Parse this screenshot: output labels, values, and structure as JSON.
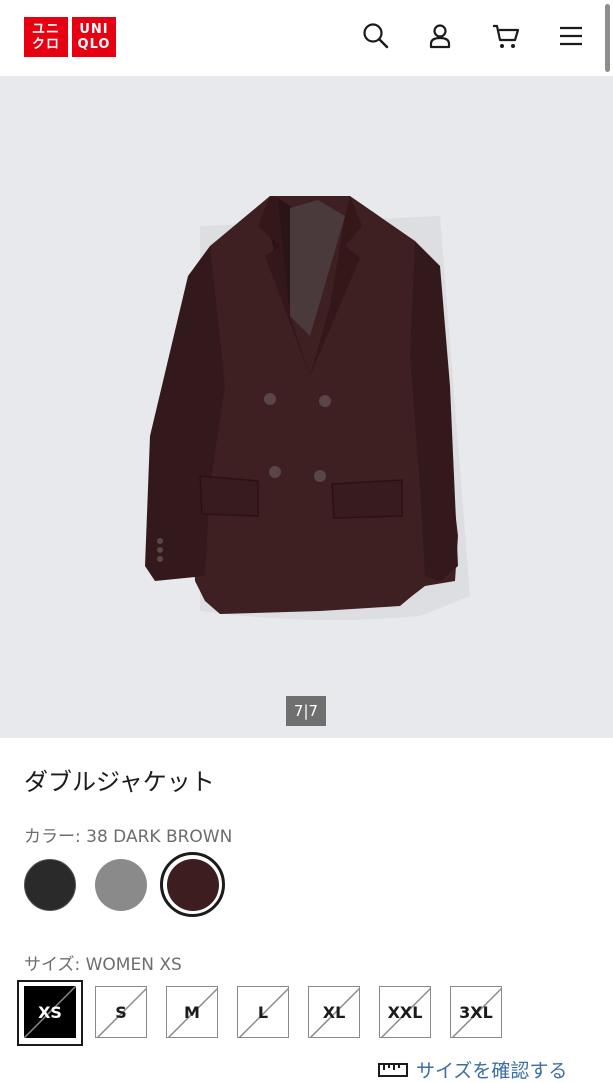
{
  "header": {
    "logo_top": "ユニ",
    "logo_bottom": "クロ",
    "logo_top_latin": "UNI",
    "logo_bottom_latin": "QLO",
    "icons": [
      "search-icon",
      "account-icon",
      "cart-icon",
      "menu-icon"
    ]
  },
  "gallery": {
    "counter": "7|7",
    "background": "#e8e9ec"
  },
  "product": {
    "title": "ダブルジャケット",
    "color_label": "カラー: 38 DARK BROWN",
    "colors": [
      {
        "name": "black",
        "hex": "#2a2a2a"
      },
      {
        "name": "gray",
        "hex": "#8a8a8a"
      },
      {
        "name": "dark-brown",
        "hex": "#3d1d1f",
        "selected": true
      }
    ],
    "size_label": "サイズ: WOMEN XS",
    "sizes": [
      "XS",
      "S",
      "M",
      "L",
      "XL",
      "XXL",
      "3XL"
    ],
    "selected_size": "XS",
    "size_guide_label": "サイズを確認する"
  },
  "colors": {
    "brand_red": "#e60012",
    "link_blue": "#3b6ea5"
  }
}
